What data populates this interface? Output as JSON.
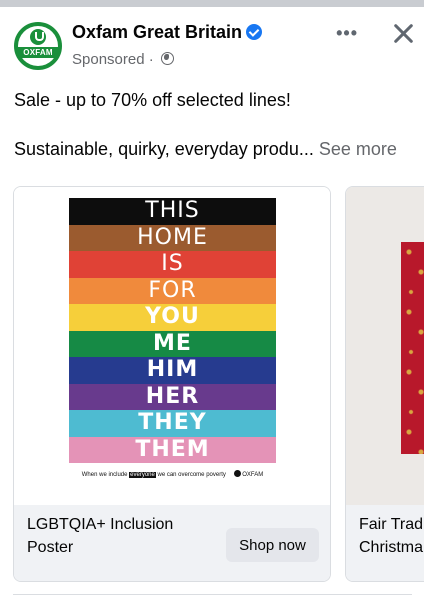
{
  "ad": {
    "page_name": "Oxfam Great Britain",
    "avatar_text": "OXFAM",
    "sponsored": "Sponsored",
    "separator": " · ",
    "more": "•••",
    "line1": "Sale - up to 70% off selected lines!",
    "line2": "Sustainable, quirky, everyday produ...",
    "see_more": "See more"
  },
  "cards": [
    {
      "title": "LGBTQIA+ Inclusion Poster",
      "button": "Shop now",
      "poster": {
        "bands": [
          {
            "text": "THIS",
            "color": "#0d0d0d"
          },
          {
            "text": "HOME",
            "color": "#9b5b2f"
          },
          {
            "text": "IS",
            "color": "#e04236"
          },
          {
            "text": "FOR",
            "color": "#f08a3c"
          },
          {
            "text": "YOU",
            "color": "#f6cf3a"
          },
          {
            "text": "ME",
            "color": "#168a45"
          },
          {
            "text": "HIM",
            "color": "#263b8f"
          },
          {
            "text": "HER",
            "color": "#683a8d"
          },
          {
            "text": "THEY",
            "color": "#4ebbd1"
          },
          {
            "text": "THEM",
            "color": "#e493b7"
          }
        ],
        "footer_pre": "When we include",
        "footer_hl": "everyone",
        "footer_post": "we can overcome poverty",
        "footer_brand": "OXFAM"
      }
    },
    {
      "title": "Fair Trad\nChristma",
      "button": ""
    }
  ]
}
